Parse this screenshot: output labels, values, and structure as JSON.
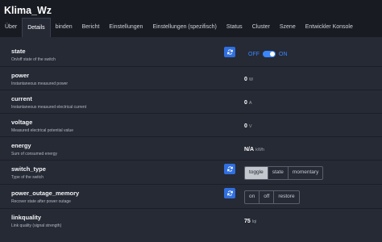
{
  "window": {
    "title": "Klima_Wz"
  },
  "tabs": [
    {
      "label": "Über",
      "active": false
    },
    {
      "label": "Details",
      "active": true
    },
    {
      "label": "binden",
      "active": false
    },
    {
      "label": "Bericht",
      "active": false
    },
    {
      "label": "Einstellungen",
      "active": false
    },
    {
      "label": "Einstellungen (spezifisch)",
      "active": false
    },
    {
      "label": "Status",
      "active": false
    },
    {
      "label": "Cluster",
      "active": false
    },
    {
      "label": "Szene",
      "active": false
    },
    {
      "label": "Entwickler Konsole",
      "active": false
    }
  ],
  "properties": {
    "state": {
      "name": "state",
      "description": "On/off state of the switch",
      "off_label": "OFF",
      "on_label": "ON",
      "value_on": true
    },
    "power": {
      "name": "power",
      "description": "Instantaneous measured power",
      "value": "0",
      "unit": "W"
    },
    "current": {
      "name": "current",
      "description": "Instantaneous measured electrical current",
      "value": "0",
      "unit": "A"
    },
    "voltage": {
      "name": "voltage",
      "description": "Measured electrical potential value",
      "value": "0",
      "unit": "V"
    },
    "energy": {
      "name": "energy",
      "description": "Sum of consumed energy",
      "value": "N/A",
      "unit": "kWh"
    },
    "switch_type": {
      "name": "switch_type",
      "description": "Type of the switch",
      "options": [
        "toggle",
        "state",
        "momentary"
      ],
      "selected": "toggle"
    },
    "power_outage_memory": {
      "name": "power_outage_memory",
      "description": "Recover state after power outage",
      "options": [
        "on",
        "off",
        "restore"
      ],
      "selected": ""
    },
    "linkquality": {
      "name": "linkquality",
      "description": "Link quality (signal strength)",
      "value": "75",
      "unit": "lqi"
    }
  },
  "colors": {
    "accent": "#3a86ff",
    "button": "#2f6fe0",
    "background": "#262a35",
    "header": "#181b22"
  },
  "icons": {
    "refresh": "refresh-icon"
  }
}
